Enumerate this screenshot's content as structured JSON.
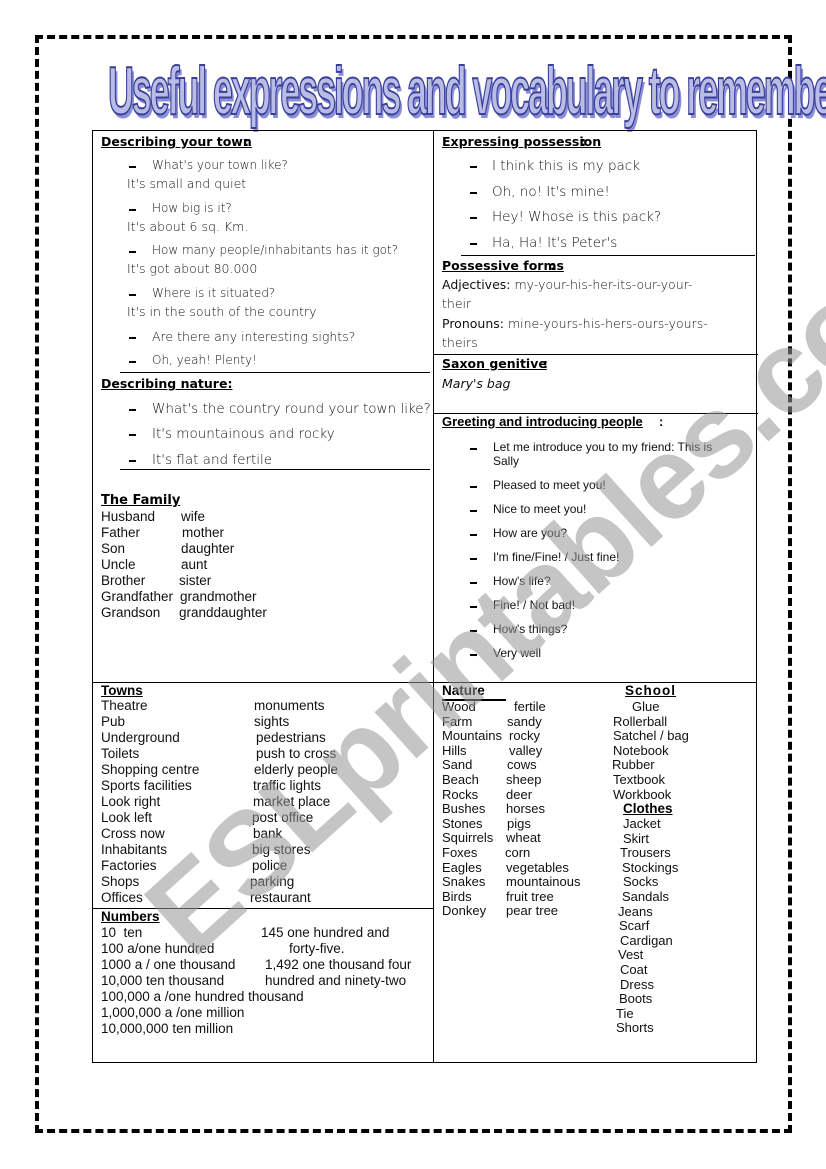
{
  "title": "Useful expressions and vocabulary to remember",
  "watermark": "ESLprintables.com",
  "describing_town": {
    "heading": "Describing your town",
    "items": [
      {
        "q": "What's your town like?",
        "a": "It's small and quiet"
      },
      {
        "q": "How big is it?",
        "a": "It's about 6 sq. Km."
      },
      {
        "q": "How many people/inhabitants has it got?",
        "a": "It's got about 80.000"
      },
      {
        "q": "Where is it situated?",
        "a": "It's in the south of the country"
      },
      {
        "q": "Are there any interesting sights?",
        "a": ""
      },
      {
        "q": "Oh, yeah! Plenty!",
        "a": ""
      }
    ]
  },
  "describing_nature": {
    "heading": "Describing nature",
    "items": [
      "What's the country round your town like?",
      "It's mountainous and rocky",
      "It's flat and fertile"
    ]
  },
  "family": {
    "heading": "The Family",
    "rows": [
      [
        "Husband",
        "wife"
      ],
      [
        "Father",
        "mother"
      ],
      [
        "Son",
        "daughter"
      ],
      [
        "Uncle",
        "aunt"
      ],
      [
        "Brother",
        "sister"
      ],
      [
        "Grandfather",
        "grandmother"
      ],
      [
        "Grandson",
        "granddaughter"
      ]
    ]
  },
  "possession": {
    "heading": "Expressing possession",
    "items": [
      "I think this is my pack",
      "Oh, no! It's mine!",
      "Hey! Whose is this pack?",
      "Ha, Ha! It's Peter's"
    ]
  },
  "possessive_forms": {
    "heading": "Possessive forms",
    "adjectives_label": "Adjectives:",
    "adjectives_line1": "my-your-his-her-its-our-your-",
    "adjectives_line2": "their",
    "pronouns_label": "Pronouns:",
    "pronouns_line1": "mine-yours-his-hers-ours-yours-",
    "pronouns_line2": "theirs"
  },
  "saxon_genitive": {
    "heading": "Saxon genitive",
    "example": "Mary's bag"
  },
  "greeting": {
    "heading": "Greeting and introducing people",
    "items": [
      "Let me introduce you to my friend: This is",
      "Sally",
      "Pleased to meet you!",
      "Nice to meet you!",
      "How are you?",
      "I'm fine/Fine! / Just fine!",
      "How's life?",
      "Fine! / Not bad!",
      "How's things?",
      "Very well"
    ]
  },
  "towns": {
    "heading": "Towns",
    "rows": [
      [
        "Theatre",
        "monuments"
      ],
      [
        "Pub",
        "sights"
      ],
      [
        "Underground",
        "pedestrians"
      ],
      [
        "Toilets",
        "push to cross"
      ],
      [
        "Shopping centre",
        "elderly people"
      ],
      [
        "Sports facilities",
        "traffic lights"
      ],
      [
        "Look right",
        "market place"
      ],
      [
        "Look left",
        "post office"
      ],
      [
        "Cross now",
        "bank"
      ],
      [
        "Inhabitants",
        "big stores"
      ],
      [
        "Factories",
        "police"
      ],
      [
        "Shops",
        "parking"
      ],
      [
        "Offices",
        "restaurant"
      ]
    ]
  },
  "numbers": {
    "heading": "Numbers",
    "left": [
      "10  ten",
      "100 a/one hundred",
      "1000 a / one thousand",
      "10,000 ten thousand",
      "100,000 a /one hundred thousand",
      "1,000,000 a /one million",
      "10,000,000 ten million"
    ],
    "right": [
      "145 one hundred and",
      "forty-five.",
      "1,492 one thousand four",
      "hundred and ninety-two"
    ]
  },
  "nature": {
    "heading": "Nature",
    "rows": [
      [
        "Wood",
        "fertile"
      ],
      [
        "Farm",
        "sandy"
      ],
      [
        "Mountains",
        "rocky"
      ],
      [
        "Hills",
        "valley"
      ],
      [
        "Sand",
        "cows"
      ],
      [
        "Beach",
        "sheep"
      ],
      [
        "Rocks",
        "deer"
      ],
      [
        "Bushes",
        "horses"
      ],
      [
        "Stones",
        "pigs"
      ],
      [
        "Squirrels",
        "wheat"
      ],
      [
        "Foxes",
        "corn"
      ],
      [
        "Eagles",
        "vegetables"
      ],
      [
        "Snakes",
        "mountainous"
      ],
      [
        "Birds",
        "fruit tree"
      ],
      [
        "Donkey",
        "pear tree"
      ]
    ]
  },
  "school": {
    "heading": "School",
    "items": [
      "Glue",
      "Rollerball",
      "Satchel / bag",
      "Notebook",
      "Rubber",
      "Textbook",
      "Workbook"
    ]
  },
  "clothes": {
    "heading": "Clothes",
    "items": [
      "Jacket",
      "Skirt",
      "Trousers",
      "Stockings",
      "Socks",
      "Sandals",
      "Jeans",
      "Scarf",
      "Cardigan",
      "Vest",
      "Coat",
      "Dress",
      "Boots",
      "Tie",
      "Shorts"
    ]
  }
}
